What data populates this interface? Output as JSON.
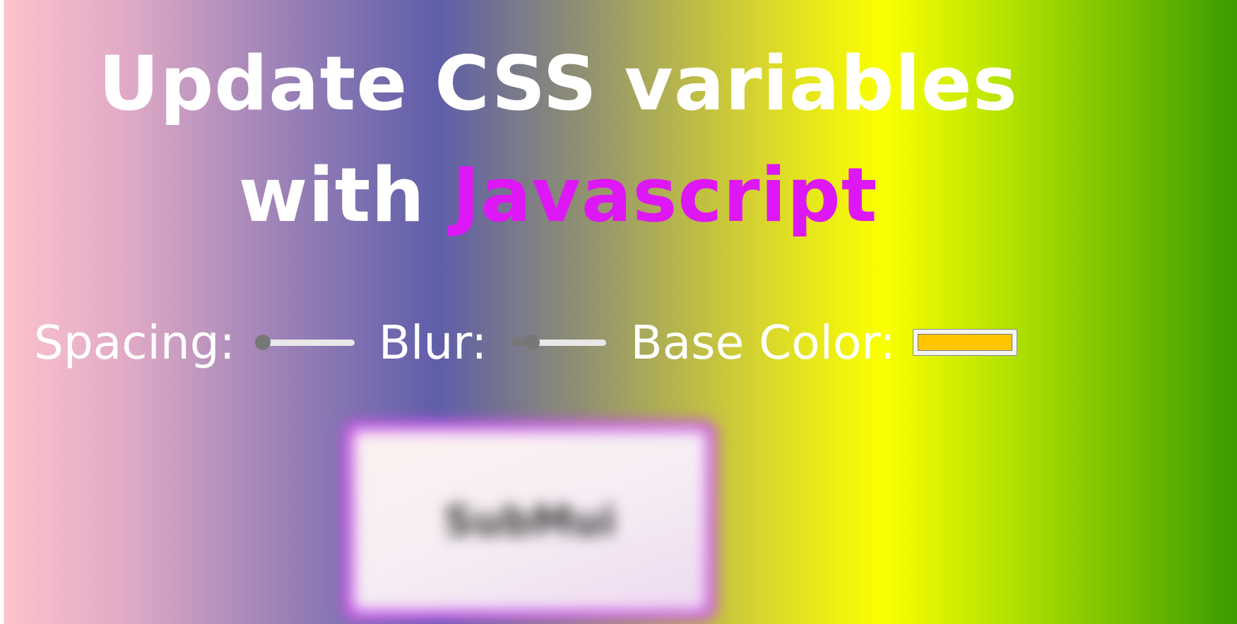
{
  "heading": {
    "line1": "Update CSS variables",
    "line2_prefix": "with ",
    "line2_highlight": "Javascript"
  },
  "controls": {
    "spacing": {
      "label": "Spacing:",
      "value_fraction": 0.0
    },
    "blur": {
      "label": "Blur:",
      "value_fraction": 0.2
    },
    "base_color": {
      "label": "Base Color:",
      "value": "#ffc600"
    }
  },
  "image": {
    "alt_text": "SubMui"
  },
  "colors": {
    "highlight": "#dd17f5",
    "image_border": "#c64ee8",
    "slider_thumb": "#777777",
    "slider_track": "#e8e8e8"
  }
}
